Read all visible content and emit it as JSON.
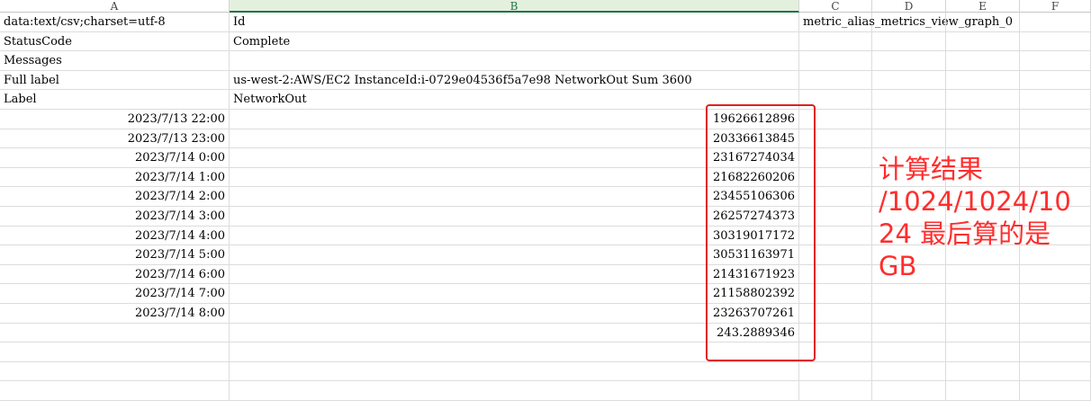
{
  "columns": [
    "A",
    "B",
    "C",
    "D",
    "E",
    "F"
  ],
  "rows": [
    {
      "a": "data:text/csv;charset=utf-8",
      "b": "Id",
      "c": "metric_alias_metrics_view_graph_0"
    },
    {
      "a": "StatusCode",
      "b": "Complete"
    },
    {
      "a": "Messages"
    },
    {
      "a": "Full label",
      "b": "us-west-2:AWS/EC2 InstanceId:i-0729e04536f5a7e98 NetworkOut Sum 3600"
    },
    {
      "a": "Label",
      "b": "NetworkOut"
    },
    {
      "a": "2023/7/13 22:00",
      "b": "19626612896"
    },
    {
      "a": "2023/7/13 23:00",
      "b": "20336613845"
    },
    {
      "a": "2023/7/14 0:00",
      "b": "23167274034"
    },
    {
      "a": "2023/7/14 1:00",
      "b": "21682260206"
    },
    {
      "a": "2023/7/14 2:00",
      "b": "23455106306"
    },
    {
      "a": "2023/7/14 3:00",
      "b": "26257274373"
    },
    {
      "a": "2023/7/14 4:00",
      "b": "30319017172"
    },
    {
      "a": "2023/7/14 5:00",
      "b": "30531163971"
    },
    {
      "a": "2023/7/14 6:00",
      "b": "21431671923"
    },
    {
      "a": "2023/7/14 7:00",
      "b": "21158802392"
    },
    {
      "a": "2023/7/14 8:00",
      "b": "23263707261"
    },
    {
      "b": "243.2889346"
    },
    {},
    {},
    {}
  ],
  "annotation": {
    "lines": [
      "计算结果",
      "/1024/1024/10",
      "24 最后算的是",
      "GB"
    ],
    "color": "#ff2d2d"
  },
  "selected_column": "B"
}
